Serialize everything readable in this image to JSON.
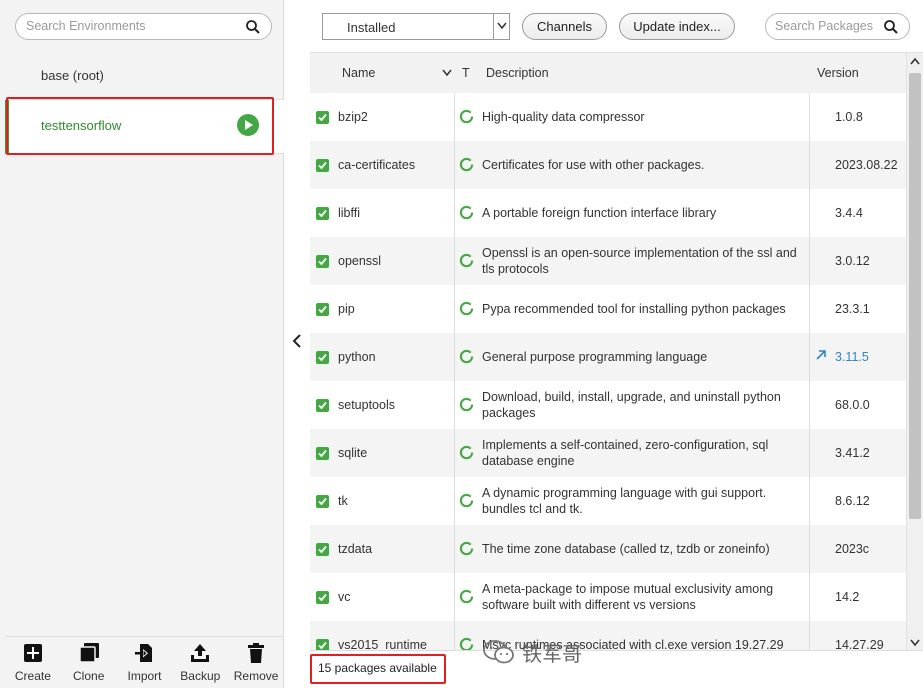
{
  "environments": {
    "search_placeholder": "Search Environments",
    "items": [
      {
        "label": "base (root)"
      },
      {
        "label": "testtensorflow"
      }
    ],
    "toolbar": [
      {
        "label": "Create",
        "icon": "plus-icon"
      },
      {
        "label": "Clone",
        "icon": "clone-icon"
      },
      {
        "label": "Import",
        "icon": "import-icon"
      },
      {
        "label": "Backup",
        "icon": "upload-icon"
      },
      {
        "label": "Remove",
        "icon": "trash-icon"
      }
    ]
  },
  "packages": {
    "filter_value": "Installed",
    "channels_label": "Channels",
    "update_index_label": "Update index...",
    "search_placeholder": "Search Packages",
    "columns": {
      "name": "Name",
      "type": "T",
      "description": "Description",
      "version": "Version"
    },
    "rows": [
      {
        "name": "bzip2",
        "description": "High-quality data compressor",
        "version": "1.0.8"
      },
      {
        "name": "ca-certificates",
        "description": "Certificates for use with other packages.",
        "version": "2023.08.22"
      },
      {
        "name": "libffi",
        "description": "A portable foreign function interface library",
        "version": "3.4.4"
      },
      {
        "name": "openssl",
        "description": "Openssl is an open-source implementation of the ssl and tls protocols",
        "version": "3.0.12"
      },
      {
        "name": "pip",
        "description": "Pypa recommended tool for installing python packages",
        "version": "23.3.1"
      },
      {
        "name": "python",
        "description": "General purpose programming language",
        "version": "3.11.5",
        "update_available": true
      },
      {
        "name": "setuptools",
        "description": "Download, build, install, upgrade, and uninstall python packages",
        "version": "68.0.0"
      },
      {
        "name": "sqlite",
        "description": "Implements a self-contained, zero-configuration, sql database engine",
        "version": "3.41.2"
      },
      {
        "name": "tk",
        "description": "A dynamic programming language with gui support. bundles tcl and tk.",
        "version": "8.6.12"
      },
      {
        "name": "tzdata",
        "description": "The time zone database (called tz, tzdb or zoneinfo)",
        "version": "2023c"
      },
      {
        "name": "vc",
        "description": "A meta-package to impose mutual exclusivity among software built with different vs versions",
        "version": "14.2"
      },
      {
        "name": "vs2015_runtime",
        "description": "Msvc runtimes associated with cl.exe version 19.27.29",
        "version": "14.27.29"
      }
    ],
    "count_text": "15 packages available"
  },
  "watermark": "铁军哥",
  "colors": {
    "accent_green": "#43a843",
    "highlight_red": "#e02020",
    "update_blue": "#2e86c1"
  }
}
